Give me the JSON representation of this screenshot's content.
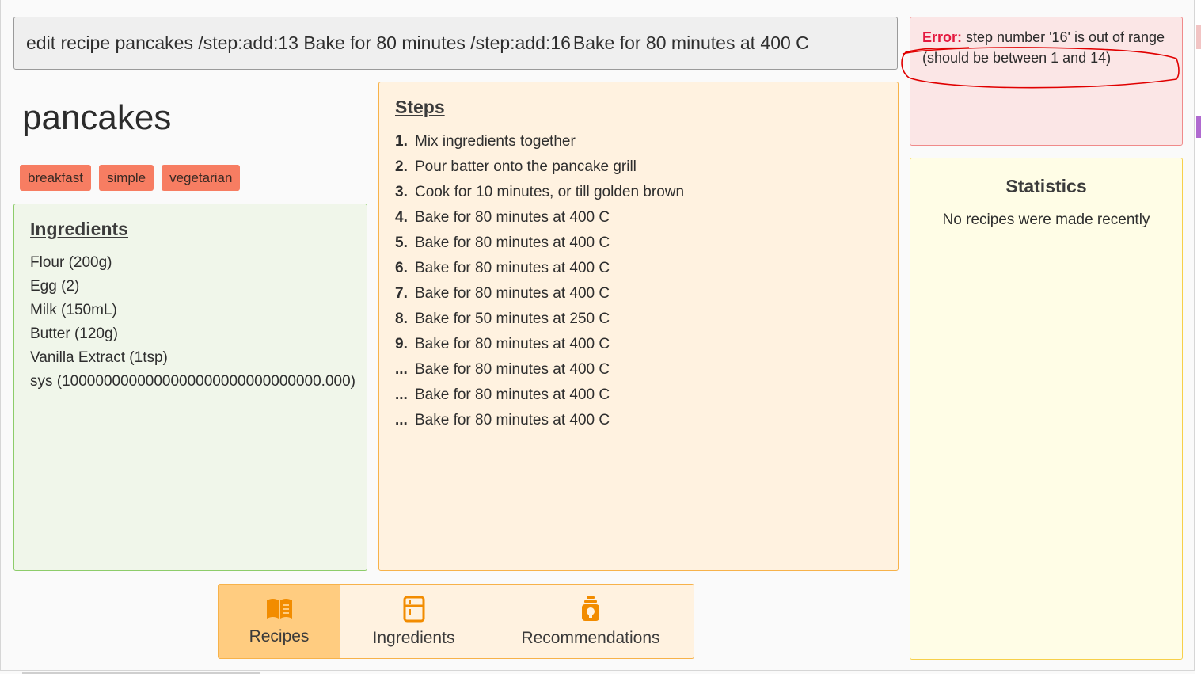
{
  "command": {
    "text_before_caret": "edit recipe pancakes  /step:add:13 Bake for 80 minutes /step:add:16",
    "text_after_caret": "Bake for 80 minutes at 400 C"
  },
  "recipe": {
    "title": "pancakes",
    "tags": [
      "breakfast",
      "simple",
      "vegetarian"
    ]
  },
  "ingredients": {
    "heading": "Ingredients",
    "items": [
      "Flour (200g)",
      "Egg (2)",
      "Milk (150mL)",
      "Butter (120g)",
      "Vanilla Extract (1tsp)",
      "sys (1000000000000000000000000000000.000)"
    ]
  },
  "steps": {
    "heading": "Steps",
    "items": [
      {
        "num": "1.",
        "text": "Mix ingredients together"
      },
      {
        "num": "2.",
        "text": "Pour batter onto the pancake grill"
      },
      {
        "num": "3.",
        "text": "Cook for 10 minutes, or till golden brown"
      },
      {
        "num": "4.",
        "text": "Bake for 80 minutes at 400 C"
      },
      {
        "num": "5.",
        "text": "Bake for 80 minutes at 400 C"
      },
      {
        "num": "6.",
        "text": "Bake for 80 minutes at 400 C"
      },
      {
        "num": "7.",
        "text": "Bake for 80 minutes at 400 C"
      },
      {
        "num": "8.",
        "text": "Bake for 50 minutes at 250 C"
      },
      {
        "num": "9.",
        "text": "Bake for 80 minutes at 400 C"
      },
      {
        "num": "...",
        "text": "Bake for 80 minutes at 400 C"
      },
      {
        "num": "...",
        "text": "Bake for 80 minutes at 400 C"
      },
      {
        "num": "...",
        "text": "Bake for 80 minutes at 400 C"
      }
    ]
  },
  "error": {
    "label": "Error:",
    "message": "step number '16' is out of range (should be between 1 and 14)"
  },
  "statistics": {
    "title": "Statistics",
    "text": "No recipes were made recently"
  },
  "tabs": [
    {
      "label": "Recipes",
      "icon": "book-icon",
      "active": true
    },
    {
      "label": "Ingredients",
      "icon": "fridge-icon",
      "active": false
    },
    {
      "label": "Recommendations",
      "icon": "lightbulb-icon",
      "active": false
    }
  ],
  "colors": {
    "tag": "#f77d62",
    "ingredients_bg": "#f0f6ea",
    "steps_bg": "#fff2e0",
    "error_bg": "#fbe6e6",
    "error_label": "#e4193f",
    "stats_bg": "#fffde6",
    "active_tab": "#ffcc80",
    "icon": "#f28c00"
  }
}
